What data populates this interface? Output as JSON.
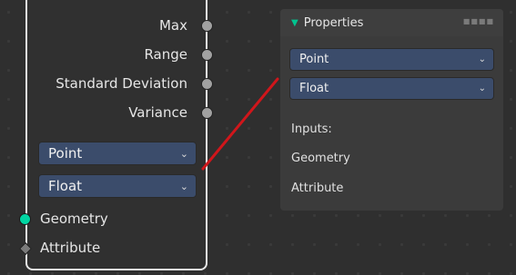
{
  "node": {
    "outputs": [
      "Max",
      "Range",
      "Standard Deviation",
      "Variance"
    ],
    "domain_value": "Point",
    "type_value": "Float",
    "inputs": [
      "Geometry",
      "Attribute"
    ]
  },
  "properties": {
    "title": "Properties",
    "domain_value": "Point",
    "type_value": "Float",
    "inputs_label": "Inputs:",
    "inputs": [
      "Geometry",
      "Attribute"
    ]
  },
  "colors": {
    "accent_green": "#00d6a3",
    "dropdown_blue": "#3b4c6b",
    "annotation_red": "#d0161b"
  }
}
